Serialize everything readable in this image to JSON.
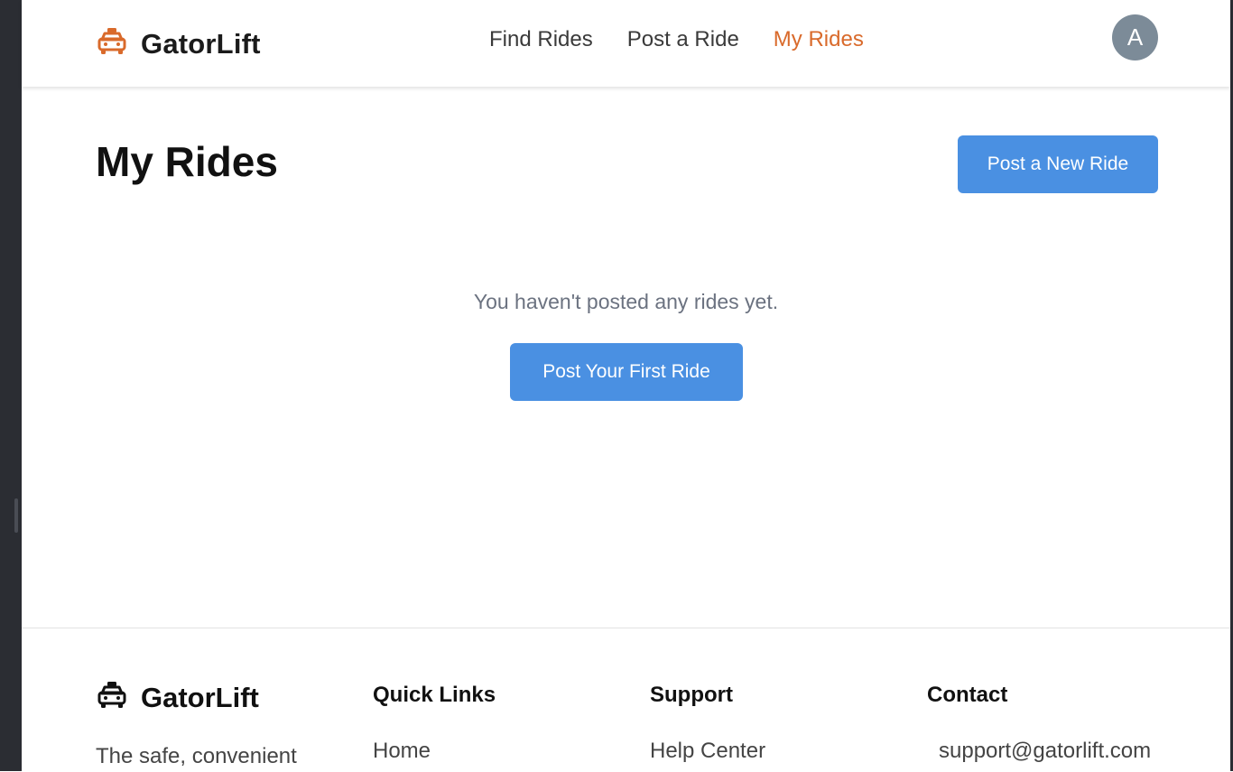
{
  "colors": {
    "accent": "#d96a2b",
    "primary_button": "#4a90e2",
    "avatar_bg": "#7c8b98",
    "muted_text": "#6b7280"
  },
  "header": {
    "brand_icon": "taxi-icon",
    "brand_name": "GatorLift",
    "nav": [
      {
        "label": "Find Rides",
        "active": false
      },
      {
        "label": "Post a Ride",
        "active": false
      },
      {
        "label": "My Rides",
        "active": true
      }
    ],
    "avatar_initial": "A"
  },
  "main": {
    "title": "My Rides",
    "new_ride_button": "Post a New Ride",
    "empty_message": "You haven't posted any rides yet.",
    "first_ride_button": "Post Your First Ride"
  },
  "footer": {
    "brand_icon": "taxi-icon",
    "brand_name": "GatorLift",
    "tagline": "The safe, convenient",
    "quick_links": {
      "heading": "Quick Links",
      "items": [
        "Home"
      ]
    },
    "support": {
      "heading": "Support",
      "items": [
        "Help Center"
      ]
    },
    "contact": {
      "heading": "Contact",
      "items": [
        "support@gatorlift.com"
      ]
    }
  }
}
